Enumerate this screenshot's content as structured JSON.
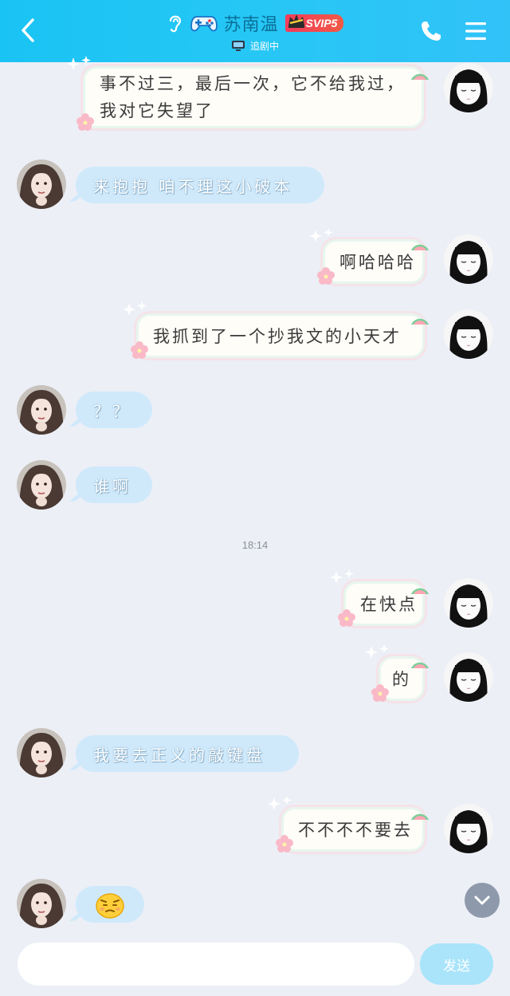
{
  "header": {
    "title": "苏南温",
    "badge": "SVIP5",
    "status": "追剧中",
    "icons": [
      "back-arrow-icon",
      "ear-icon",
      "gamepad-icon",
      "crown-icon",
      "tv-icon",
      "phone-icon",
      "menu-icon"
    ],
    "colors": {
      "bar": "#1fc4f5",
      "title": "#0b6f97",
      "badge": "#f03e57"
    }
  },
  "messages": [
    {
      "side": "right",
      "text": "事不过三，最后一次，它不给我过，我对它失望了"
    },
    {
      "side": "left",
      "text": "来抱抱 咱不理这小破本"
    },
    {
      "side": "right",
      "text": "啊哈哈哈"
    },
    {
      "side": "right",
      "text": "我抓到了一个抄我文的小天才"
    },
    {
      "side": "left",
      "text": "？？"
    },
    {
      "side": "left",
      "text": "谁啊"
    },
    {
      "side": "right",
      "text": "在快点"
    },
    {
      "side": "right",
      "text": "的"
    },
    {
      "side": "left",
      "text": "我要去正义的敲键盘"
    },
    {
      "side": "right",
      "text": "不不不不要去"
    },
    {
      "side": "left",
      "text": "",
      "emoji": "sad-face-emoji"
    }
  ],
  "time_divider": "18:14",
  "composer": {
    "placeholder": "",
    "send_label": "发送"
  }
}
